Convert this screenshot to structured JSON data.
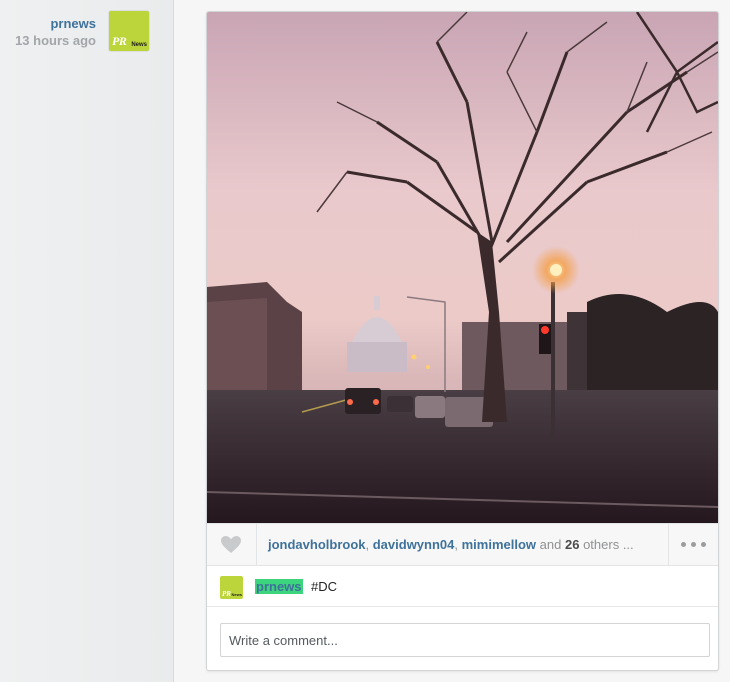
{
  "post": {
    "author": "prnews",
    "time_ago": "13 hours ago",
    "avatar_label": "PR",
    "avatar_sublabel": "News"
  },
  "likes": {
    "users": [
      "jondavholbrook",
      "davidwynn04",
      "mimimellow"
    ],
    "separator": ", ",
    "and_text": "and",
    "others_count": "26",
    "others_text": "others ..."
  },
  "caption": {
    "user": "prnews",
    "text": "#DC"
  },
  "comment": {
    "placeholder": "Write a comment..."
  },
  "icons": {
    "heart": "heart-icon",
    "more": "more-dots-icon"
  },
  "colors": {
    "link": "#3f729b",
    "avatar_bg": "#bcd53a",
    "highlight": "#3cd47c"
  }
}
